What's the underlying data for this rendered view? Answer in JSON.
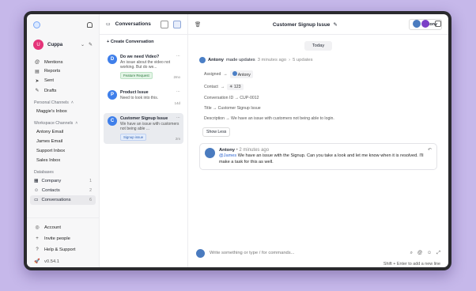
{
  "sidebar": {
    "account_initial": "U",
    "account_name": "Cuppa",
    "nav": [
      {
        "label": "Mentions",
        "icon": "at-icon"
      },
      {
        "label": "Reports",
        "icon": "chart-icon"
      },
      {
        "label": "Sent",
        "icon": "send-icon"
      },
      {
        "label": "Drafts",
        "icon": "edit-icon"
      }
    ],
    "personal_title": "Personal Channels",
    "personal_items": [
      "Maggie's Inbox"
    ],
    "workspace_title": "Workspace Channels",
    "workspace_items": [
      "Antony Email",
      "James Email",
      "Support Inbox",
      "Sales Inbox"
    ],
    "databases_title": "Databases",
    "databases": [
      {
        "label": "Company",
        "count": "1"
      },
      {
        "label": "Contacts",
        "count": "2"
      },
      {
        "label": "Conversations",
        "count": "6"
      }
    ],
    "bottom": [
      {
        "label": "Account"
      },
      {
        "label": "Invite people"
      },
      {
        "label": "Help & Support"
      },
      {
        "label": "v0.54.1"
      }
    ]
  },
  "list": {
    "title": "Conversations",
    "create_label": "+ Create Conversation",
    "cards": [
      {
        "initial": "D",
        "title": "Do we need Video?",
        "text": "An issue about the video not working. But do we...",
        "tag": "Feature Request",
        "time": "2mo"
      },
      {
        "initial": "P",
        "title": "Product Issue",
        "text": "Need to look into this.",
        "tag": "",
        "time": "14d"
      },
      {
        "initial": "C",
        "title": "Customer Signup Issue",
        "text": "We have an issue with customers not being able ...",
        "tag": "Signup issue",
        "time": "2m"
      }
    ]
  },
  "main": {
    "title": "Customer Signup Issue",
    "assignee_button": "Antony",
    "day": "Today",
    "update_author": "Antony",
    "update_text": "made updates",
    "update_time": "3 minutes ago",
    "update_count": "5 updates",
    "assigned_label": "Assigned",
    "assigned_value": "Antony",
    "contact_label": "Contact",
    "contact_value": "123",
    "conv_id": "Conversation ID → CUP-0012",
    "title_change": "Title → Customer Signup Issue",
    "description_change": "Description → We have an issue with customers not being able to login.",
    "show_less": "Show Less",
    "message": {
      "author": "Antony",
      "time": "• 2 minutes ago",
      "mention": "@James",
      "text": " We have an issue with the Signup. Can you take a look and let me know when it is resolved. I'll make a task for this as well."
    },
    "composer_placeholder": "Write something or type / for commands...",
    "composer_hint": "Shift + Enter to add a new line"
  },
  "colors": {
    "accent": "#3f7fea",
    "brand": "#e5347a",
    "background": "#c6b8ea"
  }
}
